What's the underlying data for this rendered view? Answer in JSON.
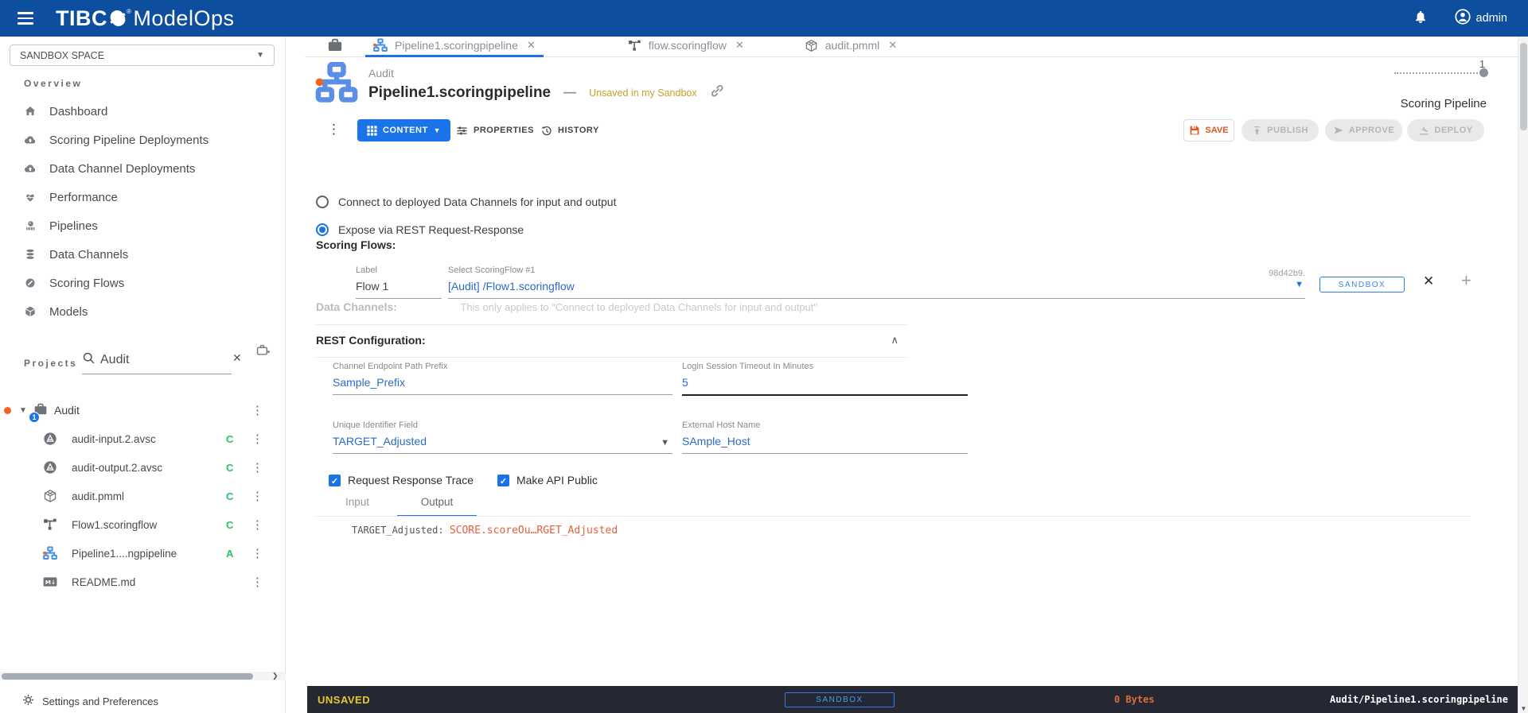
{
  "colors": {
    "topbar_blue": "#0d4f9e",
    "accent_blue": "#1a73e8",
    "link_blue": "#2b6cc4",
    "brand_orange": "#f26322",
    "unsaved_gold": "#c9a125",
    "status_yellow": "#e9c62b",
    "status_green": "#29c36a",
    "statusbar_dark": "#252833",
    "code_orange": "#e2603c"
  },
  "topbar": {
    "brand_prefix": "TIBC",
    "brand_suffix": "ModelOps",
    "user_name": "admin"
  },
  "sidebar": {
    "space_selector": "SANDBOX SPACE",
    "overview_label": "Overview",
    "nav_items": [
      {
        "label": "Dashboard",
        "icon": "home-icon"
      },
      {
        "label": "Scoring Pipeline Deployments",
        "icon": "cloud-upload-icon"
      },
      {
        "label": "Data Channel Deployments",
        "icon": "cloud-upload-icon"
      },
      {
        "label": "Performance",
        "icon": "heart-icon"
      },
      {
        "label": "Pipelines",
        "icon": "pipelines-icon"
      },
      {
        "label": "Data Channels",
        "icon": "database-icon"
      },
      {
        "label": "Scoring Flows",
        "icon": "gauge-icon"
      },
      {
        "label": "Models",
        "icon": "cube-icon"
      }
    ],
    "projects_label": "Projects",
    "project_search_value": "Audit",
    "tree": {
      "project_name": "Audit",
      "project_badge": "1",
      "files": [
        {
          "name": "audit-input.2.avsc",
          "status": "C",
          "icon": "avro-file-icon"
        },
        {
          "name": "audit-output.2.avsc",
          "status": "C",
          "icon": "avro-file-icon"
        },
        {
          "name": "audit.pmml",
          "status": "C",
          "icon": "pmml-file-icon"
        },
        {
          "name": "Flow1.scoringflow",
          "status": "C",
          "icon": "scoringflow-file-icon"
        },
        {
          "name": "Pipeline1....ngpipeline",
          "status": "A",
          "icon": "pipeline-file-icon"
        },
        {
          "name": "README.md",
          "status": "",
          "icon": "markdown-file-icon"
        }
      ]
    },
    "settings_label": "Settings and Preferences"
  },
  "tabs": [
    {
      "label": "",
      "icon": "briefcase-icon",
      "active": false,
      "closable": false
    },
    {
      "label": "Pipeline1.scoringpipeline",
      "icon": "pipeline-icon",
      "active": true,
      "closable": true
    },
    {
      "label": "flow.scoringflow",
      "icon": "scoringflow-icon",
      "active": false,
      "closable": true
    },
    {
      "label": "audit.pmml",
      "icon": "pmml-icon",
      "active": false,
      "closable": true
    }
  ],
  "header": {
    "project_name": "Audit",
    "title": "Pipeline1.scoringpipeline",
    "separator": "—",
    "status_note": "Unsaved in my Sandbox",
    "version": "1",
    "artifact_type": "Scoring Pipeline"
  },
  "toolbar": {
    "content_label": "CONTENT",
    "properties_label": "PROPERTIES",
    "history_label": "HISTORY",
    "save_label": "SAVE",
    "publish_label": "PUBLISH",
    "approve_label": "APPROVE",
    "deploy_label": "DEPLOY"
  },
  "form": {
    "radio_options": [
      {
        "label": "Connect to deployed Data Channels for input and output",
        "selected": false
      },
      {
        "label": "Expose via REST Request-Response",
        "selected": true
      }
    ],
    "scoring_flows": {
      "heading": "Scoring Flows:",
      "label_field_label": "Label",
      "label_field_value": "Flow 1",
      "select_field_label": "Select ScoringFlow #1",
      "select_field_value": "[Audit] /Flow1.scoringflow",
      "badge": "SANDBOX",
      "revision": "98d42b9."
    },
    "data_channels": {
      "heading": "Data Channels:",
      "note": "This only applies to \"Connect to deployed Data Channels for input and output\""
    },
    "rest_config": {
      "heading": "REST Configuration:",
      "fields": [
        {
          "label": "Channel Endpoint Path Prefix",
          "value": "Sample_Prefix"
        },
        {
          "label": "Login Session Timeout In Minutes",
          "value": "5"
        },
        {
          "label": "Unique Identifier Field",
          "value": "TARGET_Adjusted"
        },
        {
          "label": "External Host Name",
          "value": "SAmple_Host"
        }
      ],
      "checkboxes": [
        {
          "label": "Request Response Trace",
          "checked": true
        },
        {
          "label": "Make API Public",
          "checked": true
        }
      ],
      "io_tabs": [
        {
          "label": "Input",
          "active": false
        },
        {
          "label": "Output",
          "active": true
        }
      ],
      "mapping_key": "TARGET_Adjusted:",
      "mapping_value": "SCORE.scoreOu…RGET_Adjusted"
    }
  },
  "statusbar": {
    "state": "UNSAVED",
    "badge": "SANDBOX",
    "size": "0 Bytes",
    "path": "Audit/Pipeline1.scoringpipeline"
  }
}
